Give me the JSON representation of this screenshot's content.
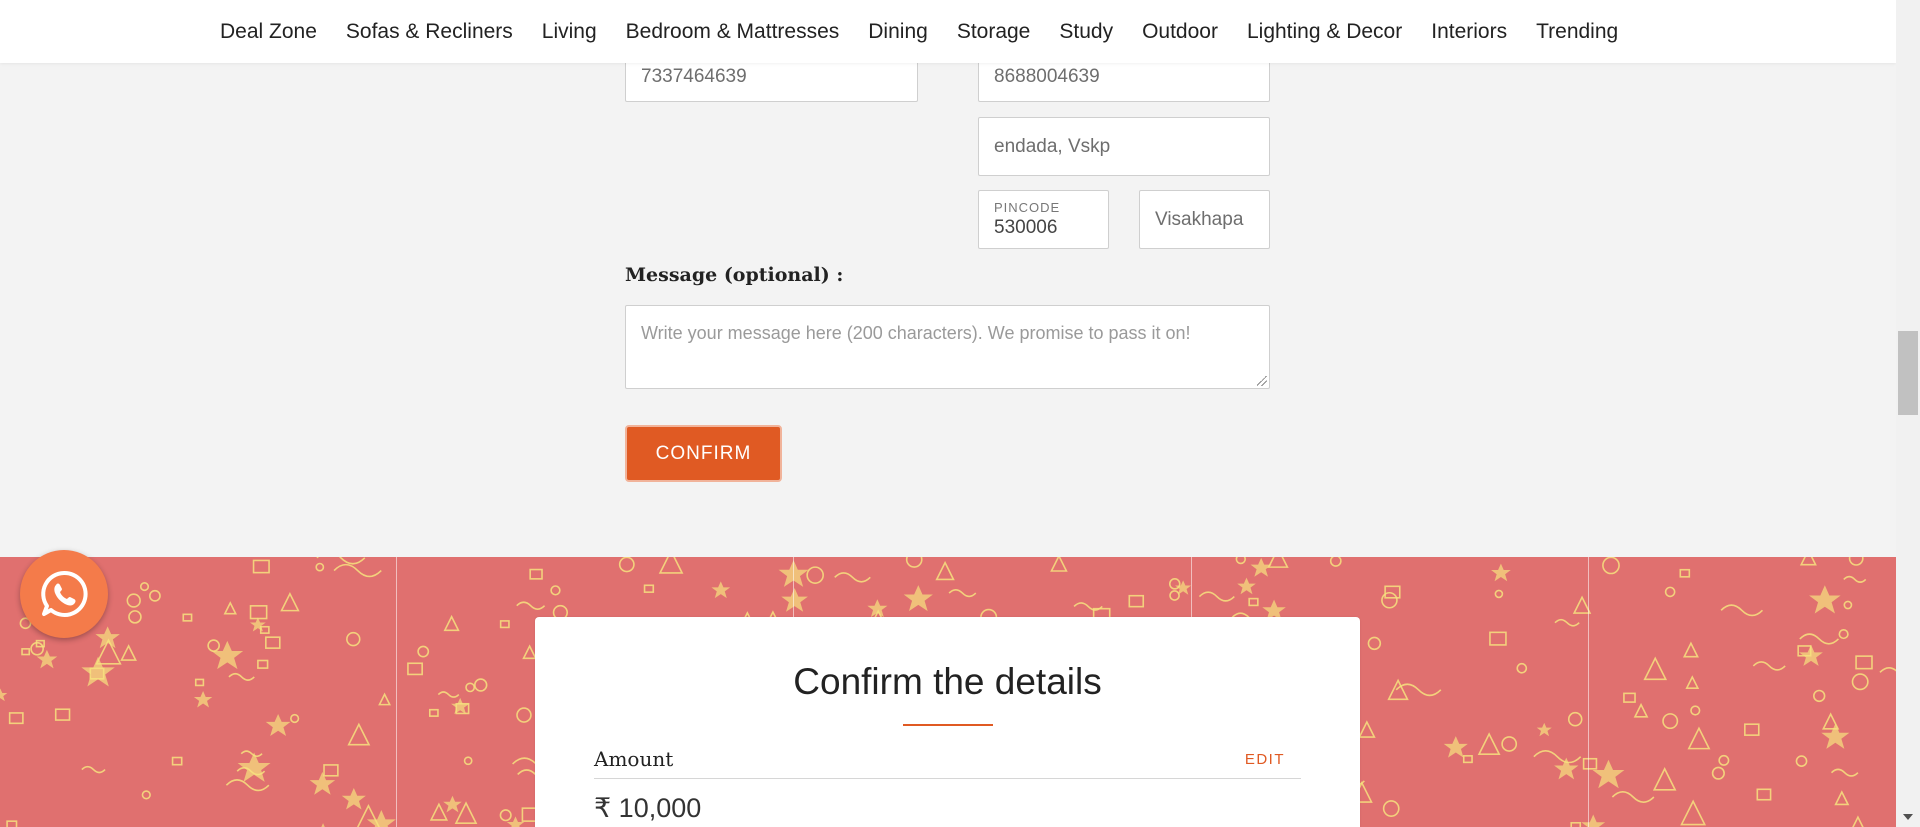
{
  "nav": {
    "items": [
      "Deal Zone",
      "Sofas & Recliners",
      "Living",
      "Bedroom & Mattresses",
      "Dining",
      "Storage",
      "Study",
      "Outdoor",
      "Lighting & Decor",
      "Interiors",
      "Trending"
    ]
  },
  "form": {
    "left_phone": "7337464639",
    "right_phone": "8688004639",
    "address": "endada, Vskp",
    "pincode_label": "PINCODE",
    "pincode": "530006",
    "city": "Visakhapa",
    "message_label": "Message (optional) :",
    "message_placeholder": "Write your message here (200 characters). We promise to pass it on!",
    "confirm_label": "CONFIRM"
  },
  "card": {
    "title": "Confirm the details",
    "amount_label": "Amount",
    "edit_label": "EDIT",
    "amount_value": "₹ 10,000"
  },
  "colors": {
    "accent": "#e05a23",
    "band": "#e0706f",
    "doodle": "#f6e27f",
    "whatsapp": "#f47b4a"
  },
  "icons": {
    "whatsapp": "whatsapp-icon"
  }
}
